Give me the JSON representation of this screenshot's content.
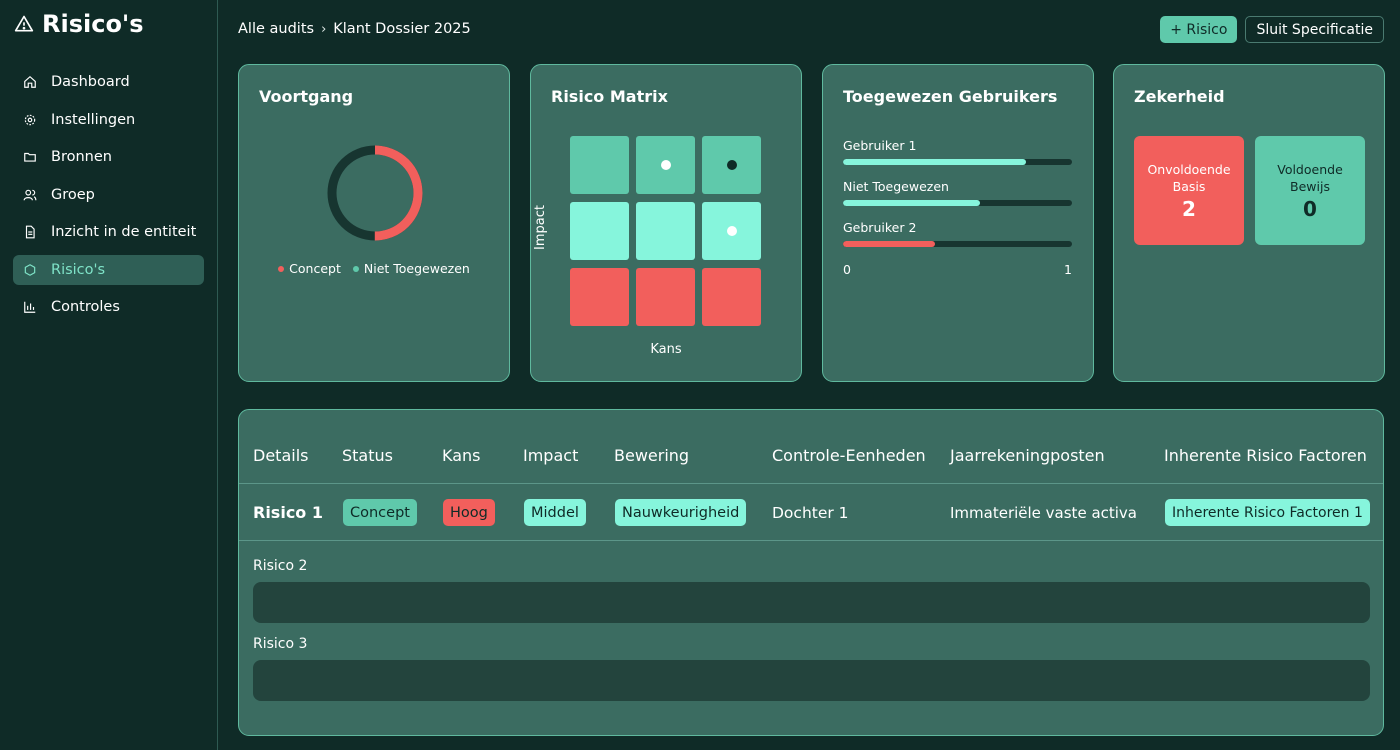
{
  "app": {
    "title": "Risico's"
  },
  "sidebar": {
    "items": [
      {
        "label": "Dashboard",
        "icon": "home-icon"
      },
      {
        "label": "Instellingen",
        "icon": "gear-icon"
      },
      {
        "label": "Bronnen",
        "icon": "folder-icon"
      },
      {
        "label": "Groep",
        "icon": "users-icon"
      },
      {
        "label": "Inzicht in de entiteit",
        "icon": "file-icon"
      },
      {
        "label": "Risico's",
        "icon": "shield-icon",
        "active": true
      },
      {
        "label": "Controles",
        "icon": "bar-chart-icon"
      }
    ]
  },
  "breadcrumb": {
    "parent": "Alle audits",
    "separator": "›",
    "current": "Klant Dossier 2025"
  },
  "toolbar": {
    "add_label": "+ Risico",
    "close_label": "Sluit Specificatie"
  },
  "voortgang": {
    "title": "Voortgang",
    "progress_fraction": 0.5,
    "legend": [
      {
        "label": "Concept",
        "color": "#f25f5c"
      },
      {
        "label": "Niet Toegewezen",
        "color": "#5fc9ab"
      }
    ]
  },
  "matrix": {
    "title": "Risico Matrix",
    "xlabel": "Kans",
    "ylabel": "Impact",
    "colors": {
      "low": "#5fc9ab",
      "medium": "#86f5dc",
      "high": "#f25f5c"
    },
    "rows": [
      [
        "low",
        "low",
        "low"
      ],
      [
        "medium",
        "medium",
        "medium"
      ],
      [
        "high",
        "high",
        "high"
      ]
    ],
    "markers": [
      {
        "row": 0,
        "col": 1,
        "color": "#ffffff"
      },
      {
        "row": 0,
        "col": 2,
        "color": "#0f2b27"
      },
      {
        "row": 1,
        "col": 2,
        "color": "#ffffff"
      }
    ]
  },
  "users": {
    "title": "Toegewezen Gebruikers",
    "items": [
      {
        "label": "Gebruiker 1",
        "value": 0.8,
        "color": "#86f5dc"
      },
      {
        "label": "Niet Toegewezen",
        "value": 0.6,
        "color": "#86f5dc"
      },
      {
        "label": "Gebruiker 2",
        "value": 0.4,
        "color": "#f25f5c"
      }
    ],
    "scale_min": "0",
    "scale_max": "1"
  },
  "zekerheid": {
    "title": "Zekerheid",
    "boxes": [
      {
        "label": "Onvoldoende Basis",
        "value": "2",
        "color": "#f25f5c"
      },
      {
        "label": "Voldoende Bewijs",
        "value": "0",
        "color": "#5fc9ab"
      }
    ]
  },
  "table": {
    "headers": [
      "Details",
      "Status",
      "Kans",
      "Impact",
      "Bewering",
      "Controle-Eenheden",
      "Jaarrekeningposten",
      "Inherente Risico Factoren"
    ],
    "row": {
      "name": "Risico 1",
      "status": "Concept",
      "kans": "Hoog",
      "impact": "Middel",
      "bewering": "Nauwkeurigheid",
      "controle": "Dochter 1",
      "jaarrekening": "Immateriële vaste activa",
      "factoren": "Inherente Risico Factoren 1"
    },
    "extra": [
      "Risico 2",
      "Risico 3"
    ]
  }
}
